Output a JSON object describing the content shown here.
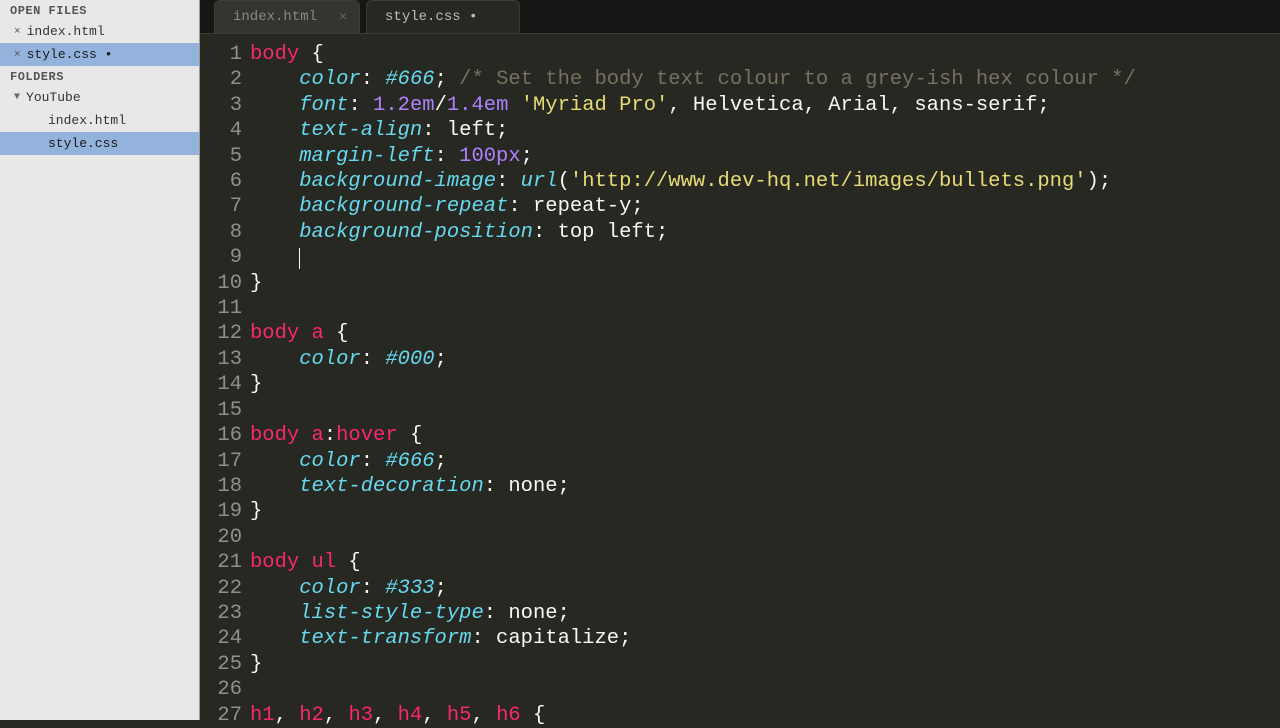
{
  "sidebar": {
    "open_files_header": "OPEN FILES",
    "open_files": [
      {
        "name": "index.html",
        "dirty": false
      },
      {
        "name": "style.css",
        "dirty": true
      }
    ],
    "folders_header": "FOLDERS",
    "root_folder": "YouTube",
    "folder_children": [
      "index.html",
      "style.css"
    ]
  },
  "tabs": [
    {
      "label": "index.html",
      "dirty": false,
      "active": false
    },
    {
      "label": "style.css",
      "dirty": true,
      "active": true
    }
  ],
  "code": {
    "lines": [
      {
        "n": 1,
        "tokens": [
          [
            "tag",
            "body"
          ],
          [
            "punc",
            " {"
          ]
        ]
      },
      {
        "n": 2,
        "tokens": [
          [
            "punc",
            "    "
          ],
          [
            "prop",
            "color"
          ],
          [
            "punc",
            ": "
          ],
          [
            "prop",
            "#666"
          ],
          [
            "punc",
            "; "
          ],
          [
            "comm",
            "/* Set the body text colour to a grey-ish hex colour */"
          ]
        ]
      },
      {
        "n": 3,
        "tokens": [
          [
            "punc",
            "    "
          ],
          [
            "prop",
            "font"
          ],
          [
            "punc",
            ": "
          ],
          [
            "num",
            "1.2em"
          ],
          [
            "punc",
            "/"
          ],
          [
            "num",
            "1.4em"
          ],
          [
            "punc",
            " "
          ],
          [
            "str",
            "'Myriad Pro'"
          ],
          [
            "punc",
            ", Helvetica, Arial, sans-serif;"
          ]
        ]
      },
      {
        "n": 4,
        "tokens": [
          [
            "punc",
            "    "
          ],
          [
            "prop",
            "text-align"
          ],
          [
            "punc",
            ": left;"
          ]
        ]
      },
      {
        "n": 5,
        "tokens": [
          [
            "punc",
            "    "
          ],
          [
            "prop",
            "margin-left"
          ],
          [
            "punc",
            ": "
          ],
          [
            "num",
            "100px"
          ],
          [
            "punc",
            ";"
          ]
        ]
      },
      {
        "n": 6,
        "tokens": [
          [
            "punc",
            "    "
          ],
          [
            "prop",
            "background-image"
          ],
          [
            "punc",
            ": "
          ],
          [
            "prop",
            "url"
          ],
          [
            "punc",
            "("
          ],
          [
            "str",
            "'http://www.dev-hq.net/images/bullets.png'"
          ],
          [
            "punc",
            ");"
          ]
        ]
      },
      {
        "n": 7,
        "tokens": [
          [
            "punc",
            "    "
          ],
          [
            "prop",
            "background-repeat"
          ],
          [
            "punc",
            ": repeat-y;"
          ]
        ]
      },
      {
        "n": 8,
        "tokens": [
          [
            "punc",
            "    "
          ],
          [
            "prop",
            "background-position"
          ],
          [
            "punc",
            ": top left;"
          ]
        ]
      },
      {
        "n": 9,
        "tokens": [
          [
            "punc",
            "    "
          ],
          [
            "cursor",
            ""
          ]
        ]
      },
      {
        "n": 10,
        "tokens": [
          [
            "punc",
            "}"
          ]
        ]
      },
      {
        "n": 11,
        "tokens": [
          [
            "punc",
            ""
          ]
        ]
      },
      {
        "n": 12,
        "tokens": [
          [
            "tag",
            "body a"
          ],
          [
            "punc",
            " {"
          ]
        ]
      },
      {
        "n": 13,
        "tokens": [
          [
            "punc",
            "    "
          ],
          [
            "prop",
            "color"
          ],
          [
            "punc",
            ": "
          ],
          [
            "prop",
            "#000"
          ],
          [
            "punc",
            ";"
          ]
        ]
      },
      {
        "n": 14,
        "tokens": [
          [
            "punc",
            "}"
          ]
        ]
      },
      {
        "n": 15,
        "tokens": [
          [
            "punc",
            ""
          ]
        ]
      },
      {
        "n": 16,
        "tokens": [
          [
            "tag",
            "body a"
          ],
          [
            "punc",
            ":"
          ],
          [
            "tag",
            "hover"
          ],
          [
            "punc",
            " {"
          ]
        ]
      },
      {
        "n": 17,
        "tokens": [
          [
            "punc",
            "    "
          ],
          [
            "prop",
            "color"
          ],
          [
            "punc",
            ": "
          ],
          [
            "prop",
            "#666"
          ],
          [
            "punc",
            ";"
          ]
        ]
      },
      {
        "n": 18,
        "tokens": [
          [
            "punc",
            "    "
          ],
          [
            "prop",
            "text-decoration"
          ],
          [
            "punc",
            ": none;"
          ]
        ]
      },
      {
        "n": 19,
        "tokens": [
          [
            "punc",
            "}"
          ]
        ]
      },
      {
        "n": 20,
        "tokens": [
          [
            "punc",
            ""
          ]
        ]
      },
      {
        "n": 21,
        "tokens": [
          [
            "tag",
            "body ul"
          ],
          [
            "punc",
            " {"
          ]
        ]
      },
      {
        "n": 22,
        "tokens": [
          [
            "punc",
            "    "
          ],
          [
            "prop",
            "color"
          ],
          [
            "punc",
            ": "
          ],
          [
            "prop",
            "#333"
          ],
          [
            "punc",
            ";"
          ]
        ]
      },
      {
        "n": 23,
        "tokens": [
          [
            "punc",
            "    "
          ],
          [
            "prop",
            "list-style-type"
          ],
          [
            "punc",
            ": none;"
          ]
        ]
      },
      {
        "n": 24,
        "tokens": [
          [
            "punc",
            "    "
          ],
          [
            "prop",
            "text-transform"
          ],
          [
            "punc",
            ": capitalize;"
          ]
        ]
      },
      {
        "n": 25,
        "tokens": [
          [
            "punc",
            "}"
          ]
        ]
      },
      {
        "n": 26,
        "tokens": [
          [
            "punc",
            ""
          ]
        ]
      },
      {
        "n": 27,
        "tokens": [
          [
            "tag",
            "h1"
          ],
          [
            "punc",
            ", "
          ],
          [
            "tag",
            "h2"
          ],
          [
            "punc",
            ", "
          ],
          [
            "tag",
            "h3"
          ],
          [
            "punc",
            ", "
          ],
          [
            "tag",
            "h4"
          ],
          [
            "punc",
            ", "
          ],
          [
            "tag",
            "h5"
          ],
          [
            "punc",
            ", "
          ],
          [
            "tag",
            "h6"
          ],
          [
            "punc",
            " {"
          ]
        ]
      }
    ]
  }
}
